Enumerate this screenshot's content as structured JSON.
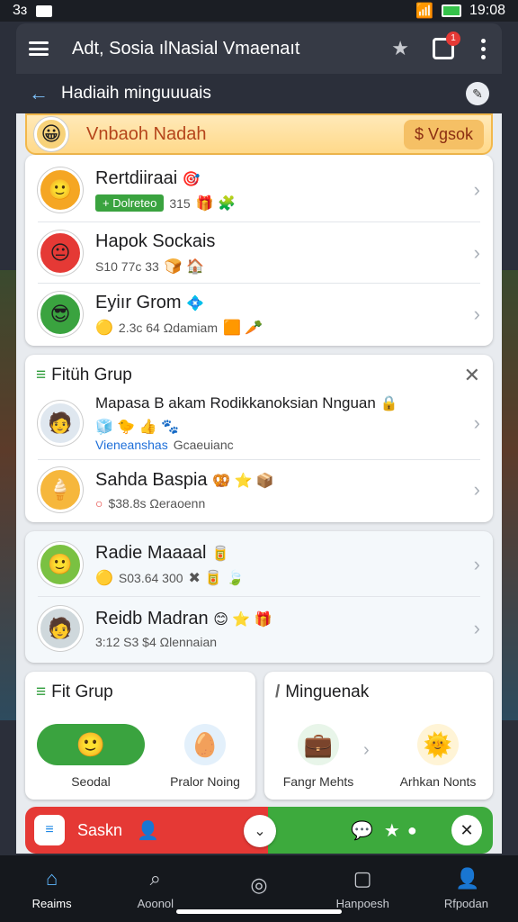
{
  "status_bar": {
    "left_text": "3ɜ",
    "time": "19:08"
  },
  "app_bar": {
    "title": "Adt, Sosia ılNasial Vmaenaıt",
    "tabs_badge": "1"
  },
  "sub_bar": {
    "title": "Hadiaih minguuuais"
  },
  "banner": {
    "title": "Vnbaoh Nadah",
    "chip": "$ Vgsok",
    "avatar_icon": "😀"
  },
  "contacts": [
    {
      "name": "Rertdiiraai",
      "status": "+ Dolreteo",
      "meta": "315",
      "avatar_icon": "🙂",
      "avatar_bg": "#f5a623",
      "icons": "🎯 🧩"
    },
    {
      "name": "Hapok Sockais",
      "status": "",
      "meta": "S10 77c 33",
      "avatar_icon": "😐",
      "avatar_bg": "#e53935",
      "icons": "🍞 🏠"
    },
    {
      "name": "Eyiır Grom",
      "status": "",
      "meta": "2.3c 64 Ωdamiam",
      "avatar_icon": "😎",
      "avatar_bg": "#3aa33f",
      "icons": "🟧 🥕"
    }
  ],
  "fit_group": {
    "title": "Fitüh Grup",
    "items": [
      {
        "name": "Mapasa B akam Rodikkanoksian Nnguan",
        "meta_link": "Vieneanshas",
        "meta": "Gcaeuianc",
        "avatar_icon": "🧑",
        "avatar_bg": "#dfe7ef",
        "icons": "🧊 🐤 👍 🐾"
      },
      {
        "name": "Sahda Baspia",
        "meta_link": "",
        "meta": "$38.8s Ωeraoenn",
        "avatar_icon": "🍦",
        "avatar_bg": "#f6b73c",
        "icons": "🥨 ⭐ 36c 📦"
      }
    ]
  },
  "recent": [
    {
      "name": "Radie Maaaal",
      "meta": "S03.64 300",
      "avatar_icon": "🙂",
      "avatar_bg": "#7ac142",
      "icons": "🥫 🍃"
    },
    {
      "name": "Reidb Madran",
      "meta": "3:12 S3 $4 Ωlennaian",
      "avatar_icon": "🧑",
      "avatar_bg": "#cfd8dc",
      "icons": "😊 ⭐ 3:6 🎁"
    }
  ],
  "fit_grup_tile": {
    "title": "Fit Grup",
    "items": [
      {
        "label": "Seodal",
        "icon": "🙂"
      },
      {
        "label": "Pralor Noing",
        "icon": "🥚"
      }
    ]
  },
  "minguenak_tile": {
    "title": "Minguenak",
    "items": [
      {
        "label": "Fangr Mehts",
        "icon": "💼"
      },
      {
        "label": "Arhkan Nonts",
        "icon": "🌞"
      }
    ]
  },
  "action_bar": {
    "label": "Saskn",
    "app_icon": "≡"
  },
  "bottom_nav": [
    {
      "label": "Reaims",
      "icon": "⌂"
    },
    {
      "label": "Aoonol",
      "icon": "⌕"
    },
    {
      "label": "",
      "icon": "◎"
    },
    {
      "label": "Hanpoesh",
      "icon": "▢"
    },
    {
      "label": "Rfpodan",
      "icon": "👤"
    }
  ]
}
